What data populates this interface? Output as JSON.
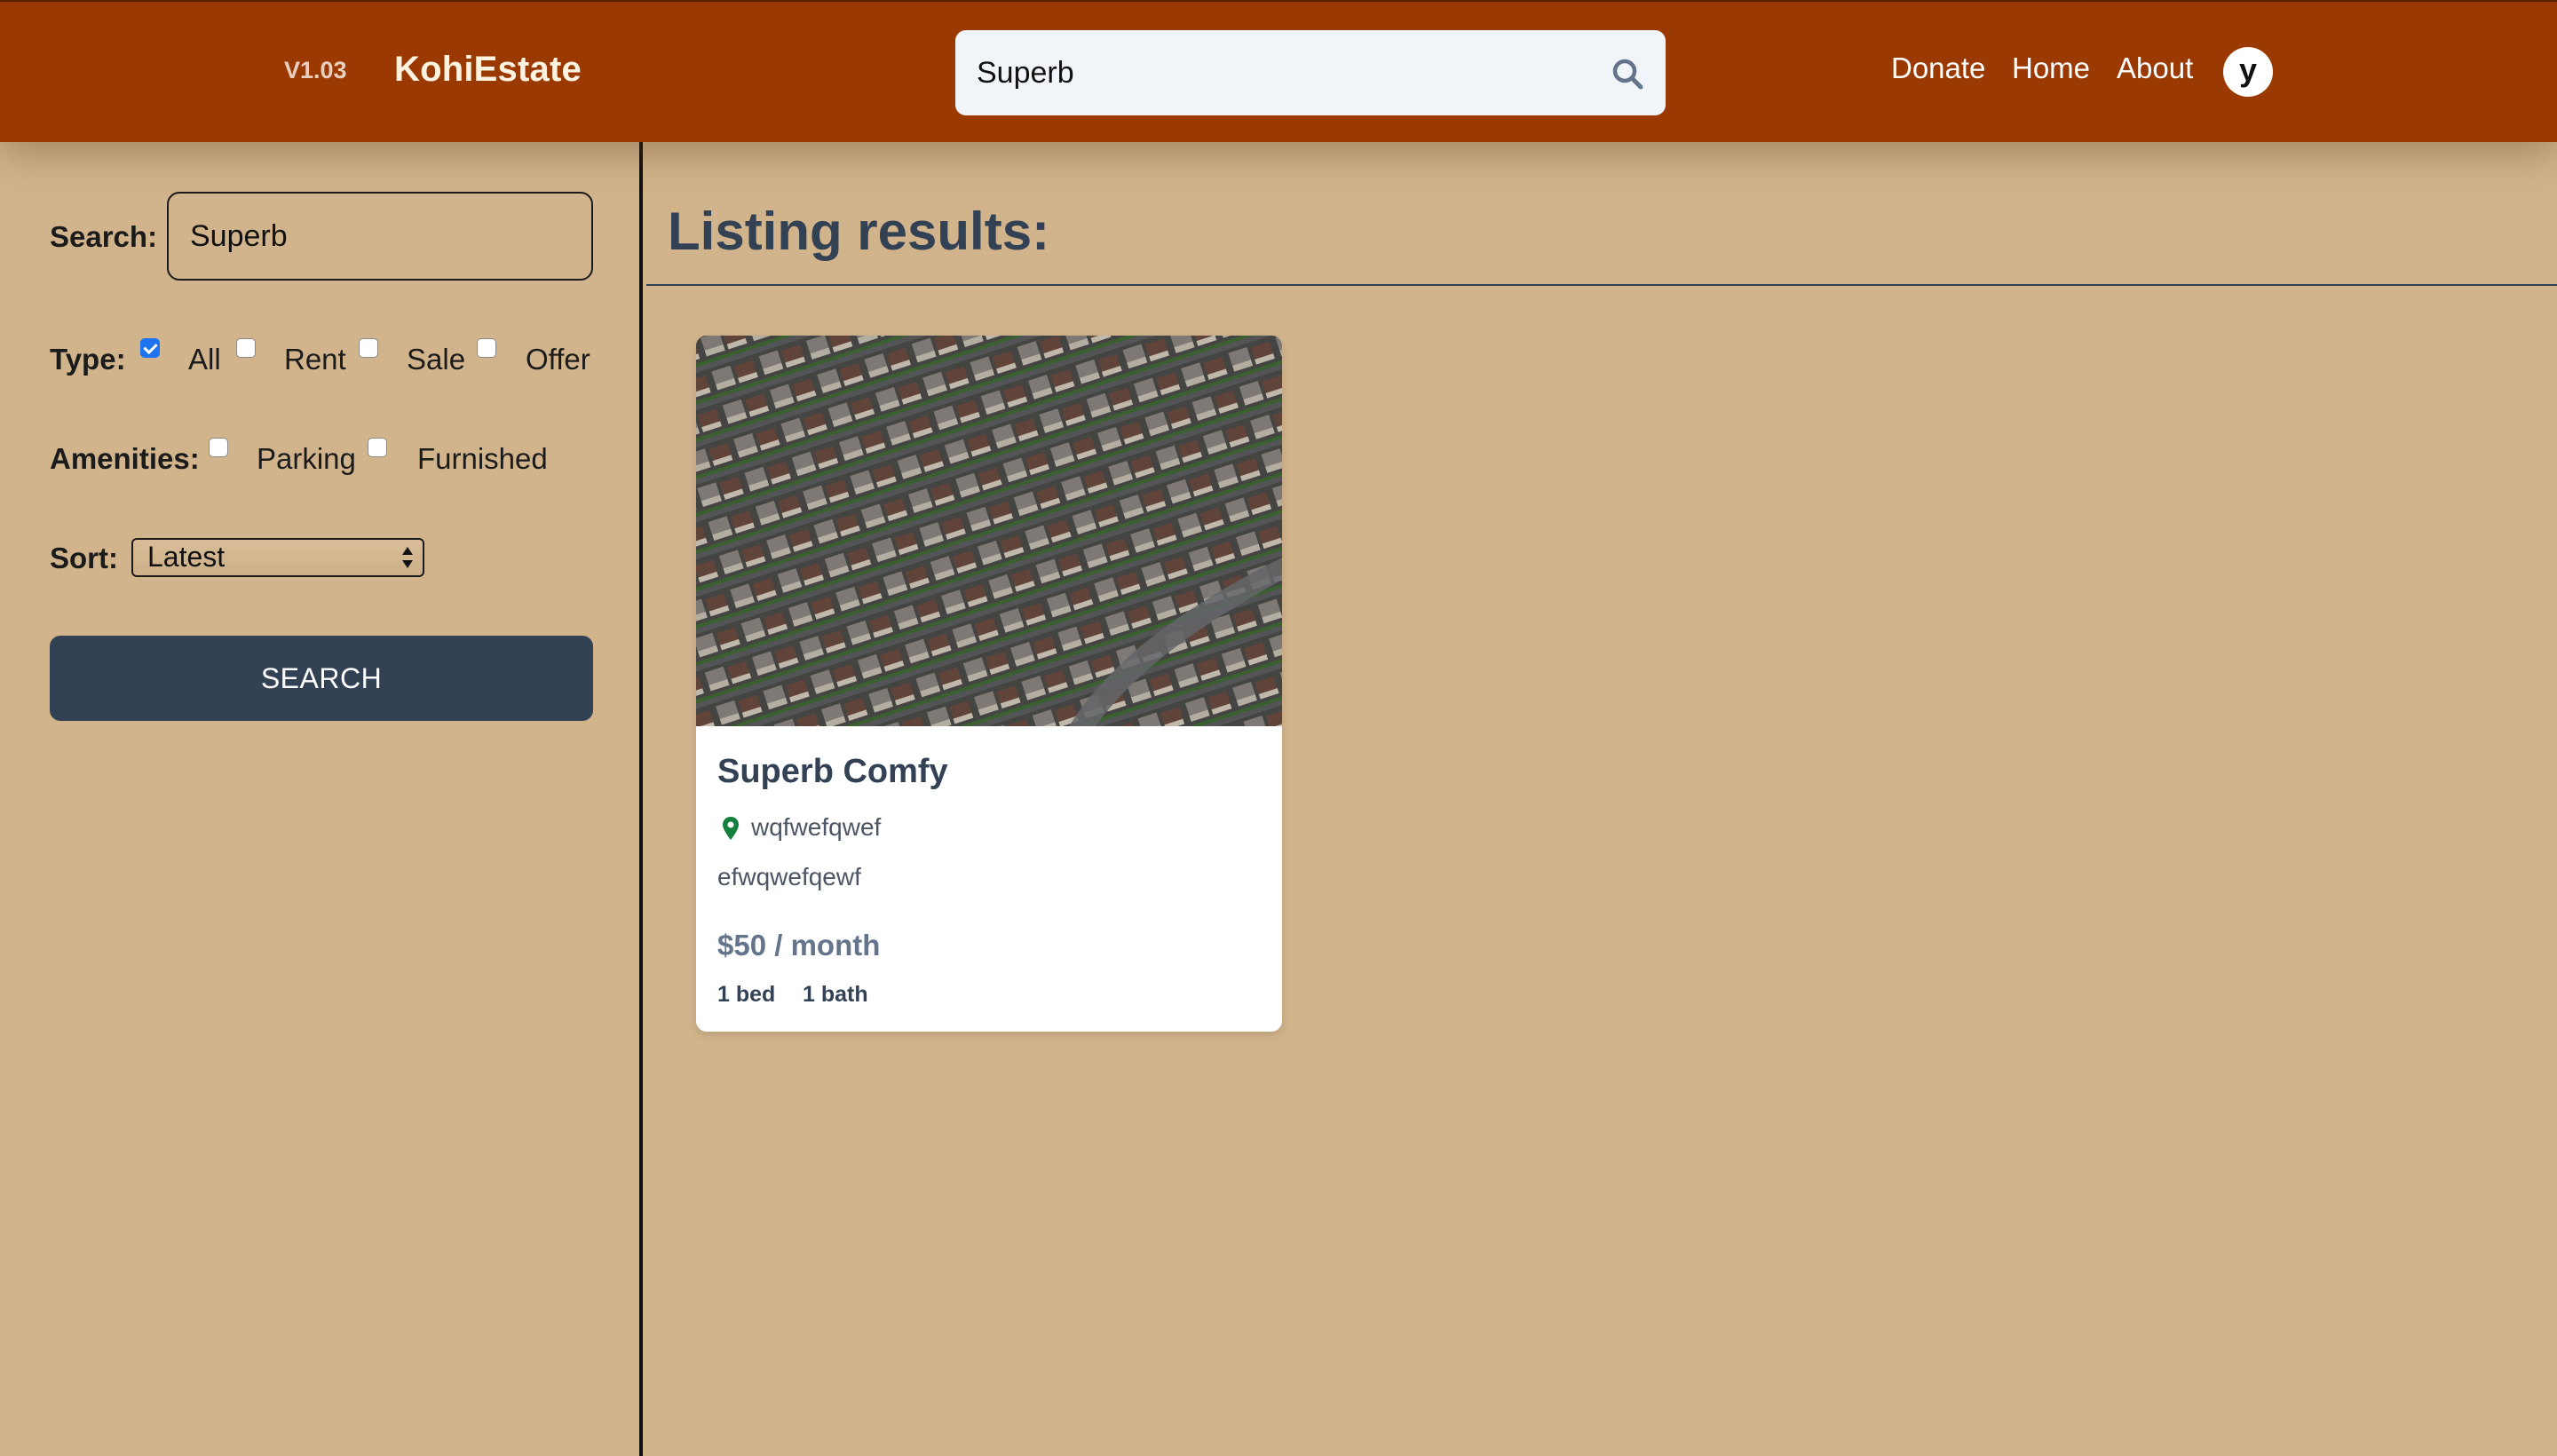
{
  "header": {
    "version": "V1.03",
    "brand": "KohiEstate",
    "search_value": "Superb",
    "nav": [
      "Donate",
      "Home",
      "About"
    ],
    "avatar_letter": "y",
    "search_icon": "search-icon"
  },
  "sidebar": {
    "search_label": "Search:",
    "search_value": "Superb",
    "type_label": "Type:",
    "types": [
      {
        "label": "All",
        "checked": true
      },
      {
        "label": "Rent",
        "checked": false
      },
      {
        "label": "Sale",
        "checked": false
      },
      {
        "label": "Offer",
        "checked": false
      }
    ],
    "amenities_label": "Amenities:",
    "amenities": [
      {
        "label": "Parking",
        "checked": false
      },
      {
        "label": "Furnished",
        "checked": false
      }
    ],
    "sort_label": "Sort:",
    "sort_value": "Latest",
    "search_button": "SEARCH"
  },
  "main": {
    "title": "Listing results:",
    "listings": [
      {
        "title": "Superb Comfy",
        "address": "wqfwefqwef",
        "description": "efwqwefqewf",
        "price": "$50 / month",
        "beds": "1 bed",
        "baths": "1 bath",
        "image": "aerial-suburban-houses-photo"
      }
    ]
  },
  "colors": {
    "header_bg": "#9a3a02",
    "page_bg": "#d2b48c",
    "primary": "#334155",
    "checkbox_accent": "#1e74f0",
    "pin": "#15803d"
  }
}
